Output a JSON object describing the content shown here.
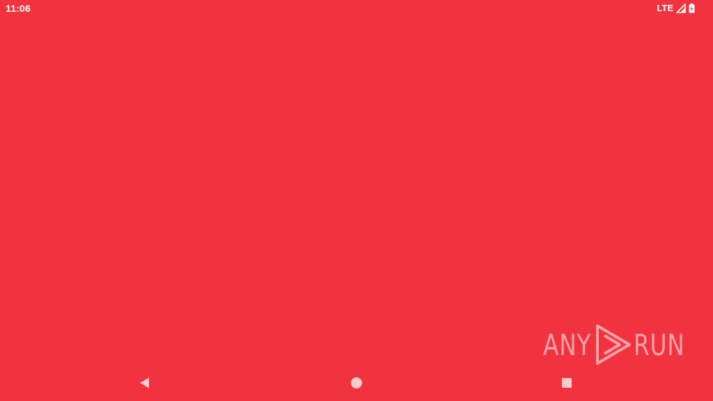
{
  "status_bar": {
    "time": "11:06",
    "network": "LTE",
    "icons": [
      "signal-icon",
      "battery-charging-icon"
    ]
  },
  "watermark": {
    "left_text": "ANY",
    "right_text": "RUN",
    "logo_icon": "play-triangle-icon"
  },
  "nav_bar": {
    "buttons": [
      "back-icon",
      "home-icon",
      "recents-icon"
    ]
  },
  "colors": {
    "background": "#f1323f",
    "foreground": "#ffffff"
  }
}
